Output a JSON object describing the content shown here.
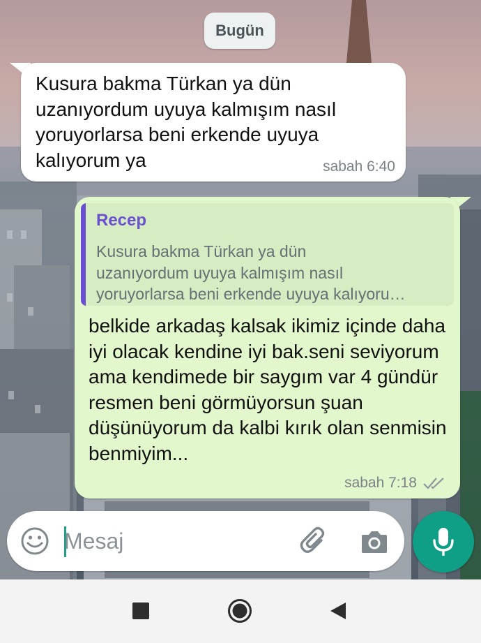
{
  "chat": {
    "date_chip": "Bugün",
    "incoming": {
      "text": "Kusura bakma Türkan ya dün uzanıyordum uyuya kalmışım nasıl yoruyorlarsa beni erkende uyuya kalıyorum ya",
      "time": "sabah 6:40"
    },
    "outgoing": {
      "quote": {
        "author": "Recep",
        "lines": [
          "Kusura bakma Türkan ya dün",
          "uzanıyordum uyuya kalmışım nasıl",
          "yoruyorlarsa beni erkende uyuya kalıyoru…"
        ]
      },
      "text": "belkide arkadaş kalsak ikimiz içinde daha iyi olacak kendine iyi bak.seni seviyorum ama kendimede bir saygım var 4 gündür resmen beni görmüyorsun şuan düşünüyorum da kalbi kırık olan senmisin benmiyim...",
      "time": "sabah 7:18",
      "status_icon": "double-check-read-icon"
    }
  },
  "composer": {
    "placeholder": "Mesaj",
    "value": "",
    "emoji_icon": "emoji-icon",
    "attach_icon": "paperclip-icon",
    "camera_icon": "camera-icon",
    "mic_icon": "microphone-icon"
  },
  "colors": {
    "outgoing_bubble": "#e2f7cb",
    "incoming_bubble": "#ffffff",
    "accent": "#0e9f86",
    "quote_bar": "#6b4fd1"
  },
  "nav": {
    "recents_icon": "square-icon",
    "home_icon": "circle-icon",
    "back_icon": "triangle-back-icon"
  }
}
